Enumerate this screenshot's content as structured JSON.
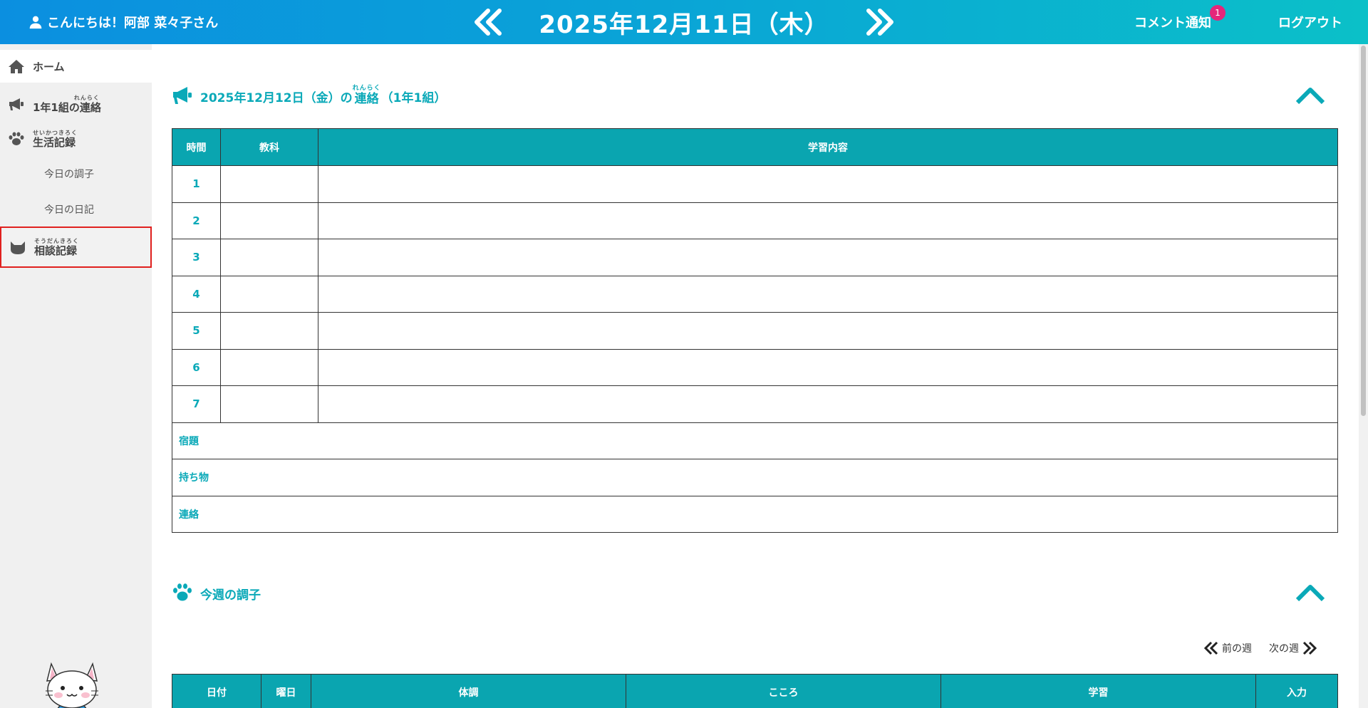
{
  "header": {
    "greeting": "こんにちは！阿部 菜々子さん",
    "date": "2025年12月11日（木）",
    "notify_label": "コメント通知",
    "notify_count": "1",
    "logout_label": "ログアウト"
  },
  "sidebar": {
    "home": "ホーム",
    "class_notice": {
      "label": "1年1組の連絡",
      "ruby": "れんらく"
    },
    "life_record": {
      "label": "生活記録",
      "ruby": "せいかつきろく"
    },
    "condition": "今日の調子",
    "diary": "今日の日記",
    "consult": {
      "label": "相談記録",
      "ruby": "そうだんきろく"
    }
  },
  "notice_section": {
    "title_prefix": "2025年12月12日（金）の",
    "title_ruby_word": "連絡",
    "title_ruby": "れんらく",
    "title_suffix": "（1年1組）",
    "columns": [
      "時間",
      "教科",
      "学習内容"
    ],
    "periods": [
      "1",
      "2",
      "3",
      "4",
      "5",
      "6",
      "7"
    ],
    "extra_rows": [
      "宿題",
      "持ち物",
      "連絡"
    ]
  },
  "week_section": {
    "title": "今週の調子",
    "prev_week": "前の週",
    "next_week": "次の週",
    "columns": [
      "日付",
      "曜日",
      "体調",
      "こころ",
      "学習",
      "入力"
    ]
  },
  "colors": {
    "accent": "#0aa5b0",
    "header_start": "#0b8fe0",
    "header_end": "#0bc0c8",
    "badge": "#e5267a",
    "selected_border": "#e0201e"
  }
}
